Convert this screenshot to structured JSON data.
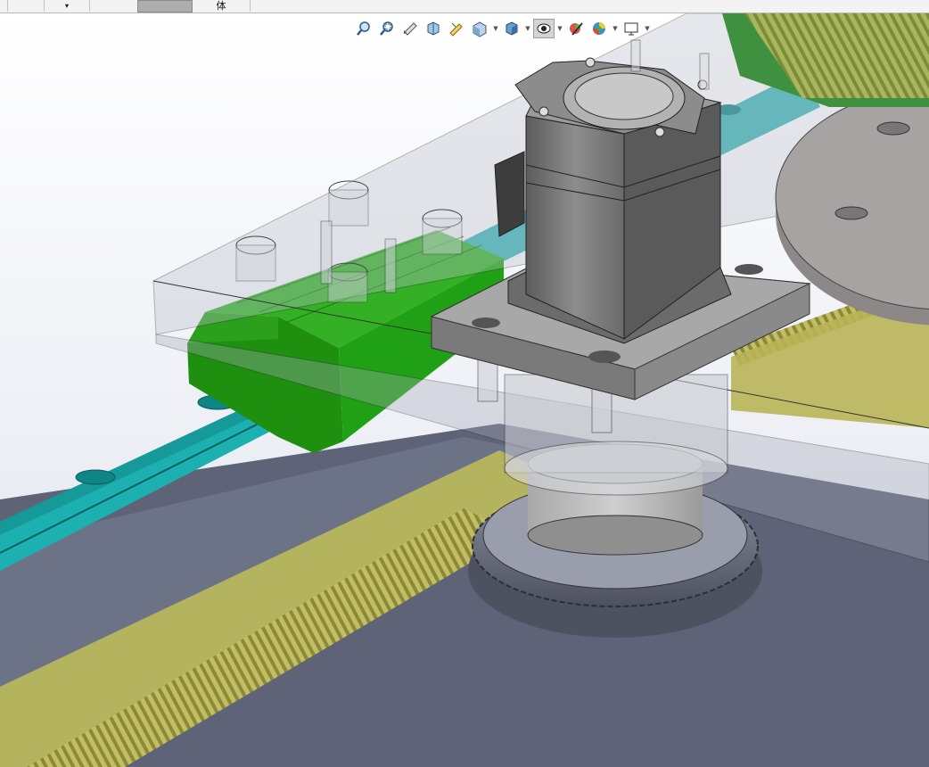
{
  "tabs": [
    {
      "label": ""
    },
    {
      "label": ""
    },
    {
      "label": "▾"
    },
    {
      "label": ""
    },
    {
      "label": "体"
    },
    {
      "label": ""
    }
  ],
  "heads_up_toolbar": {
    "buttons": [
      {
        "icon": "zoom-to-fit-icon"
      },
      {
        "icon": "zoom-to-area-icon"
      },
      {
        "icon": "previous-view-icon"
      },
      {
        "icon": "section-view-icon"
      },
      {
        "icon": "dynamic-annotation-view-icon"
      },
      {
        "icon": "view-orientation-icon"
      },
      {
        "icon": "display-style-icon"
      },
      {
        "icon": "hide-show-items-icon"
      },
      {
        "icon": "edit-appearance-icon"
      },
      {
        "icon": "apply-scene-icon"
      },
      {
        "icon": "view-settings-icon"
      }
    ]
  },
  "colors": {
    "carriage_green": "#2f9e1a",
    "rail_teal": "#1aa5a5",
    "rack_yellow": "#b8b456",
    "gear_gray": "#6e7180",
    "motor_gray": "#7c7c7c",
    "plate_transparent": "#9aa0b0"
  }
}
